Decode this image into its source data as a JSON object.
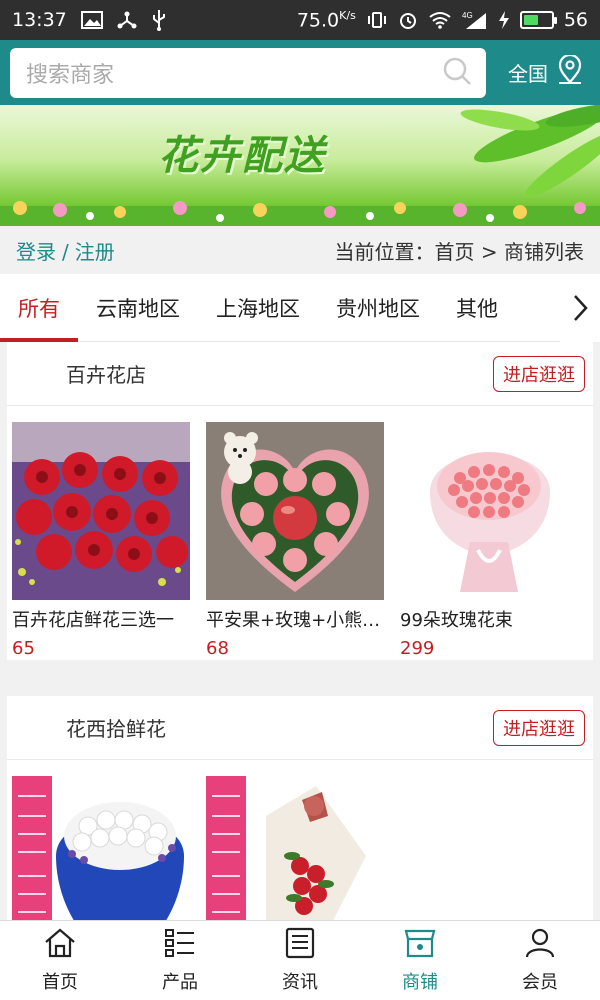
{
  "statusbar": {
    "time": "13:37",
    "speed": "75.0",
    "speed_unit": "K/s",
    "network": "4G",
    "battery_level": "56",
    "battery_fraction": 0.56
  },
  "header": {
    "search_placeholder": "搜索商家",
    "region_label": "全国"
  },
  "banner": {
    "title": "花卉配送"
  },
  "breadcrumb": {
    "login": "登录",
    "separator": "/",
    "register": "注册",
    "location": "当前位置：首页 > 商铺列表"
  },
  "tabs": [
    {
      "label": "所有",
      "active": true
    },
    {
      "label": "云南地区",
      "active": false
    },
    {
      "label": "上海地区",
      "active": false
    },
    {
      "label": "贵州地区",
      "active": false
    },
    {
      "label": "其他",
      "active": false
    }
  ],
  "shops": [
    {
      "name": "百卉花店",
      "visit_label": "进店逛逛",
      "products": [
        {
          "name": "百卉花店鲜花三选一",
          "price": "65"
        },
        {
          "name": "平安果+玫瑰+小熊…",
          "price": "68"
        },
        {
          "name": "99朵玫瑰花束",
          "price": "299"
        }
      ]
    },
    {
      "name": "花西拾鲜花",
      "visit_label": "进店逛逛",
      "products": []
    }
  ],
  "bottom_nav": [
    {
      "label": "首页",
      "icon": "home-icon",
      "active": false
    },
    {
      "label": "产品",
      "icon": "list-icon",
      "active": false
    },
    {
      "label": "资讯",
      "icon": "news-icon",
      "active": false
    },
    {
      "label": "商铺",
      "icon": "shop-icon",
      "active": true
    },
    {
      "label": "会员",
      "icon": "user-icon",
      "active": false
    }
  ],
  "colors": {
    "accent": "#1f8a8a",
    "highlight_red": "#c21f24"
  }
}
